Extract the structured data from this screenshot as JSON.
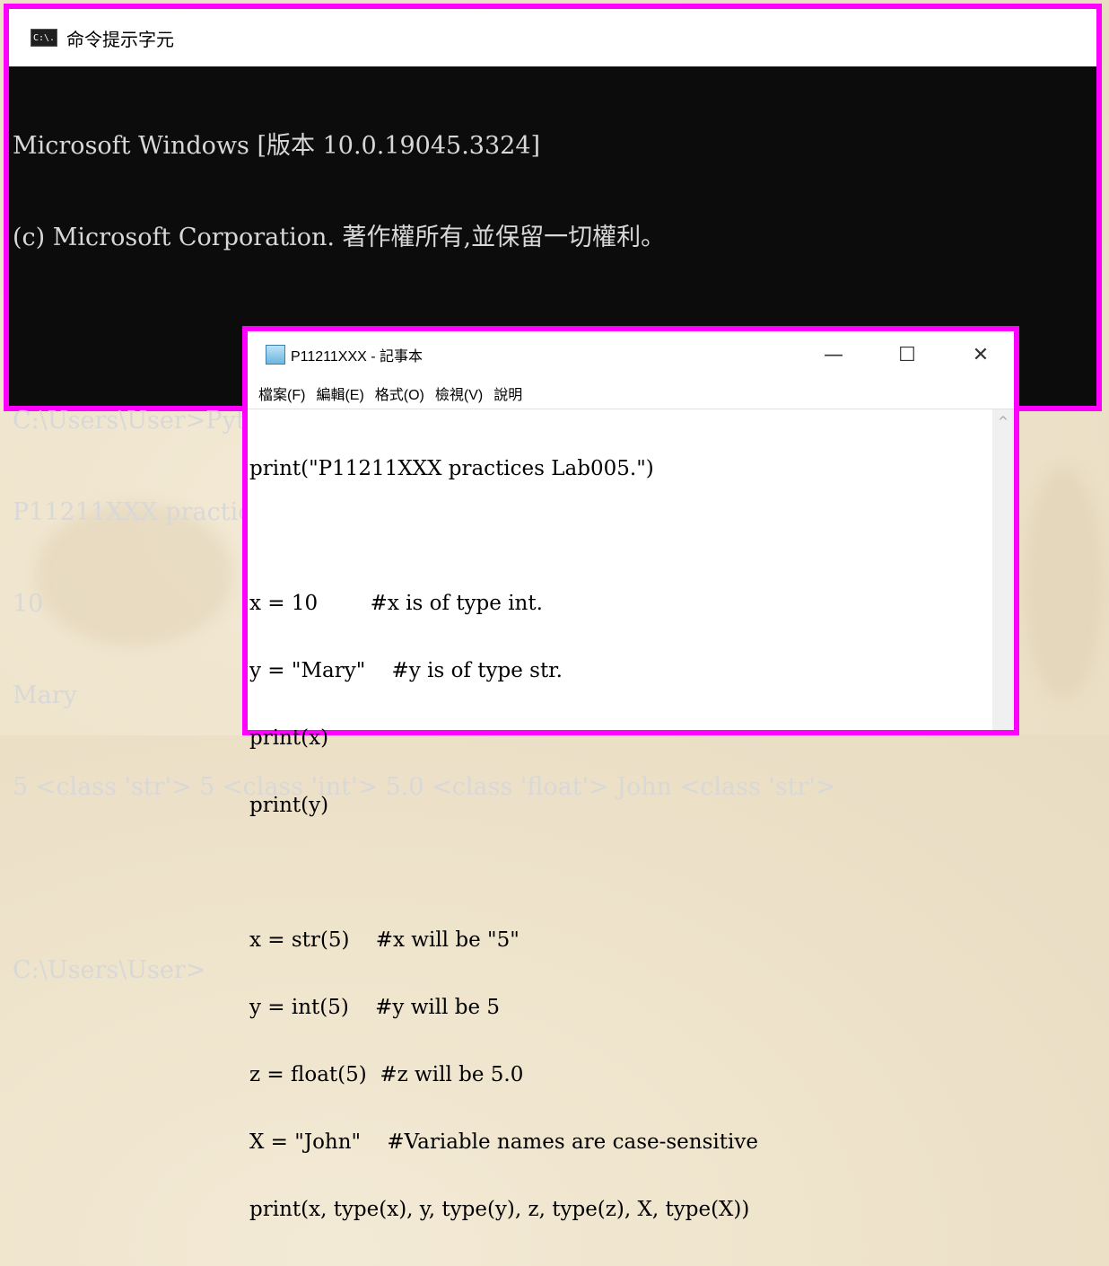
{
  "cmd": {
    "title": "命令提示字元",
    "icon": "cmd-icon",
    "icon_text": "C:\\.",
    "lines": [
      "Microsoft Windows [版本 10.0.19045.3324]",
      "(c) Microsoft Corporation. 著作權所有,並保留一切權利。",
      "",
      "C:\\Users\\User>Python P11211XXX.py",
      "P11211XXX practices Lab005.",
      "10",
      "Mary",
      "5 <class 'str'> 5 <class 'int'> 5.0 <class 'float'> John <class 'str'>",
      "",
      "C:\\Users\\User>"
    ]
  },
  "notepad": {
    "title": "P11211XXX - 記事本",
    "icon": "notepad-icon",
    "controls": {
      "minimize": "—",
      "maximize": "☐",
      "close": "✕"
    },
    "menu": [
      "檔案(F)",
      "編輯(E)",
      "格式(O)",
      "檢視(V)",
      "說明"
    ],
    "lines": [
      "print(\"P11211XXX practices Lab005.\")",
      "",
      "x = 10        #x is of type int.",
      "y = \"Mary\"    #y is of type str.",
      "print(x)",
      "print(y)",
      "",
      "x = str(5)    #x will be \"5\"",
      "y = int(5)    #y will be 5",
      "z = float(5)  #z will be 5.0",
      "X = \"John\"    #Variable names are case-sensitive",
      "print(x, type(x), y, type(y), z, type(z), X, type(X))"
    ],
    "scroll_up": "^"
  },
  "colors": {
    "highlight_border": "#ff00ff",
    "console_bg": "#0c0c0c",
    "console_fg": "#d8d8d8"
  }
}
